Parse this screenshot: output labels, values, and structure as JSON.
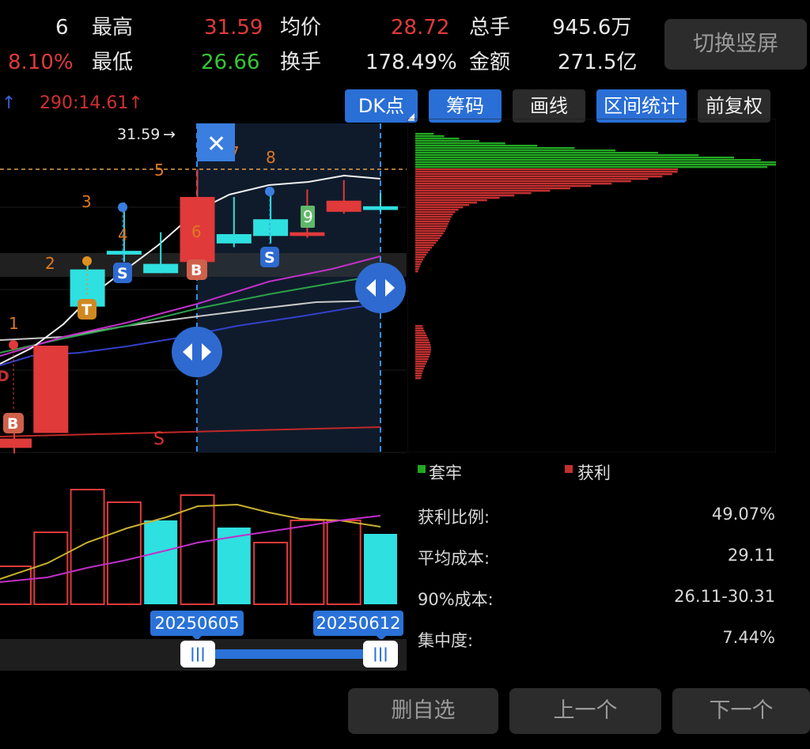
{
  "header": {
    "prefix_value": "6",
    "change_pct": "8.10%",
    "high_label": "最高",
    "high_value": "31.59",
    "low_label": "最低",
    "low_value": "26.66",
    "avg_label": "均价",
    "avg_value": "28.72",
    "turnover_label": "换手",
    "turnover_value": "178.49%",
    "total_vol_label": "总手",
    "total_vol_value": "945.6万",
    "amount_label": "金额",
    "amount_value": "271.5亿",
    "switch_button": "切换竖屏"
  },
  "toolbar": {
    "ma_readout": "290:14.61",
    "dk_button": "DK点",
    "chip_button": "筹码",
    "draw_button": "画线",
    "range_stat_button": "区间统计",
    "adjust_button": "前复权"
  },
  "chart_labels": {
    "high_marker": "31.59",
    "candle_numbers": [
      "1",
      "2",
      "3",
      "4",
      "5",
      "6",
      "7",
      "8",
      "9"
    ],
    "signal_b": "B",
    "signal_s": "S",
    "signal_t": "T",
    "signal_d": "D",
    "line_s": "S"
  },
  "chips": {
    "legend_trapped": "套牢",
    "legend_profit": "获利",
    "rows": [
      {
        "label": "获利比例:",
        "value": "49.07%"
      },
      {
        "label": "平均成本:",
        "value": "29.11"
      },
      {
        "label": "90%成本:",
        "value": "26.11-30.31"
      },
      {
        "label": "集中度:",
        "value": "7.44%"
      }
    ]
  },
  "range": {
    "start_date": "20250605",
    "end_date": "20250612"
  },
  "footer": {
    "remove_favorite": "删自选",
    "previous": "上一个",
    "next": "下一个"
  },
  "colors": {
    "up": "#e03a3a",
    "down": "#2fe0e0",
    "accent": "#2a6fd6",
    "trapped": "#22a822",
    "profit": "#c23030"
  },
  "chart_data": {
    "type": "candlestick",
    "candles": [
      {
        "label": "1",
        "open": 16.6,
        "close": 17.1,
        "high": 17.4,
        "low": 16.3
      },
      {
        "label": "2",
        "open": 17.4,
        "close": 22.1,
        "high": 22.1,
        "low": 17.4
      },
      {
        "label": "3",
        "open": 26.2,
        "close": 24.2,
        "high": 26.6,
        "low": 24.0
      },
      {
        "label": "4",
        "open": 27.2,
        "close": 27.0,
        "high": 29.8,
        "low": 26.6
      },
      {
        "label": "5",
        "open": 26.5,
        "close": 26.0,
        "high": 28.2,
        "low": 26.0
      },
      {
        "label": "6",
        "open": 26.6,
        "close": 30.1,
        "high": 31.59,
        "low": 26.5
      },
      {
        "label": "7",
        "open": 28.1,
        "close": 27.6,
        "high": 30.1,
        "low": 27.4
      },
      {
        "label": "8",
        "open": 28.9,
        "close": 28.0,
        "high": 30.5,
        "low": 27.6
      },
      {
        "label": "9",
        "open": 28.0,
        "close": 28.2,
        "high": 30.5,
        "low": 27.9
      },
      {
        "label": "",
        "open": 29.3,
        "close": 29.9,
        "high": 31.0,
        "low": 29.2
      },
      {
        "label": "",
        "open": 29.6,
        "close": 29.4,
        "high": 30.3,
        "low": 29.3
      }
    ],
    "volume": [
      {
        "value": 48,
        "up": true
      },
      {
        "value": 91,
        "up": true
      },
      {
        "value": 145,
        "up": true
      },
      {
        "value": 129,
        "up": true
      },
      {
        "value": 106,
        "up": false
      },
      {
        "value": 138,
        "up": true
      },
      {
        "value": 97,
        "up": false
      },
      {
        "value": 78,
        "up": true
      },
      {
        "value": 106,
        "up": true
      },
      {
        "value": 106,
        "up": true
      },
      {
        "value": 89,
        "up": false
      }
    ]
  }
}
